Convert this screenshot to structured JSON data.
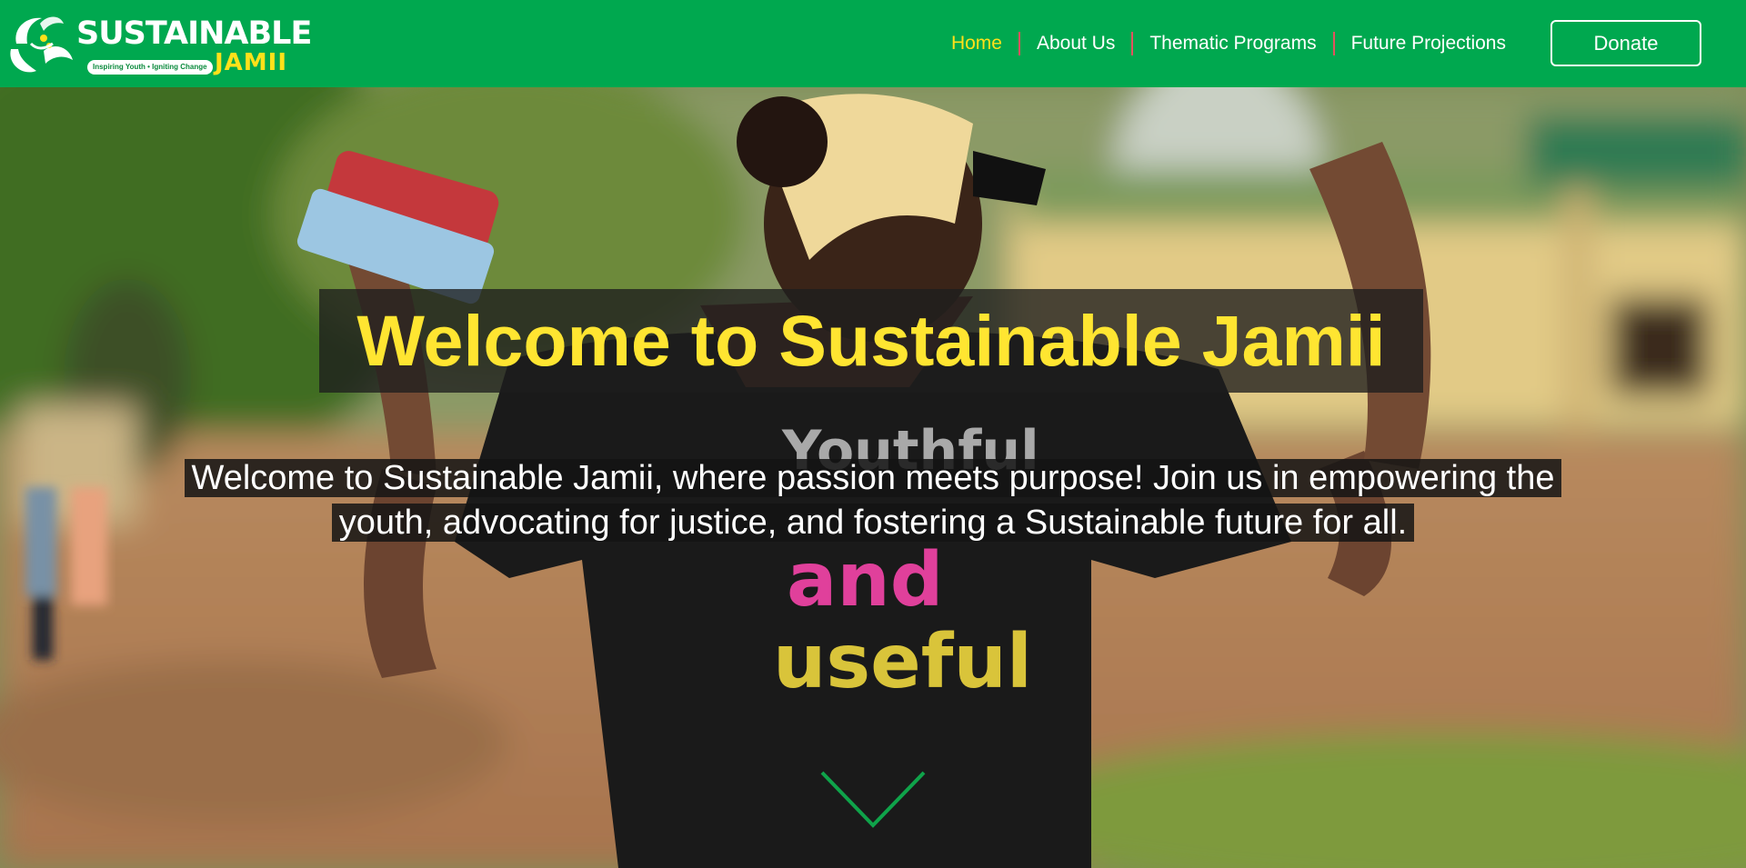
{
  "brand": {
    "name": "SUSTAINABLE",
    "subname": "JAMII",
    "tagline": "Inspiring Youth • Igniting Change",
    "logo_icon": "leaf-globe-logo-icon",
    "colors": {
      "primary": "#00a84f",
      "accent": "#ffe11a",
      "separator": "#e3525f"
    }
  },
  "nav": {
    "items": [
      {
        "label": "Home",
        "active": true
      },
      {
        "label": "About Us",
        "active": false
      },
      {
        "label": "Thematic Programs",
        "active": false
      },
      {
        "label": "Future Projections",
        "active": false
      }
    ],
    "donate_label": "Donate"
  },
  "hero": {
    "title": "Welcome to Sustainable Jamii",
    "text": "Welcome to Sustainable Jamii, where passion meets purpose! Join us in empowering the youth, advocating for justice, and fostering a Sustainable future for all.",
    "scroll_icon": "chevron-down-icon",
    "title_color": "#ffe531",
    "chevron_color": "#0fa34a"
  }
}
